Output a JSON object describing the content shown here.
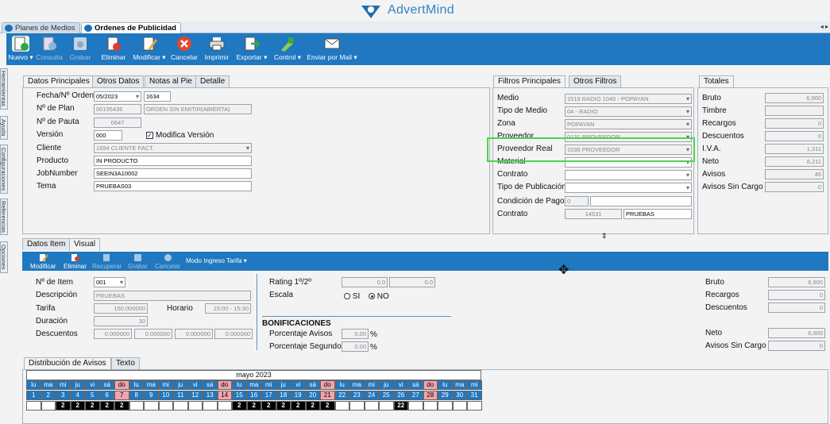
{
  "brand": {
    "name": "AdvertMind"
  },
  "doc_tabs": [
    {
      "label": "Planes de Medios"
    },
    {
      "label": "Ordenes de Publicidad"
    }
  ],
  "toolbar": [
    {
      "label": "Nuevo",
      "icon": "new-doc-icon"
    },
    {
      "label": "Consulta",
      "icon": "query-icon"
    },
    {
      "label": "Grabar",
      "icon": "save-icon"
    },
    {
      "label": "Eliminar",
      "icon": "delete-icon"
    },
    {
      "label": "Modificar",
      "icon": "edit-icon"
    },
    {
      "label": "Cancelar",
      "icon": "cancel-icon"
    },
    {
      "label": "Imprimir",
      "icon": "print-icon"
    },
    {
      "label": "Exportar",
      "icon": "export-icon"
    },
    {
      "label": "Control",
      "icon": "control-icon"
    },
    {
      "label": "Enviar por Mail",
      "icon": "mail-icon"
    }
  ],
  "side_tabs": [
    "Herramientas",
    "Ayuda",
    "Configuraciones",
    "Referencias",
    "Opciones"
  ],
  "main_tabs": [
    "Datos Principales",
    "Otros Datos",
    "Notas al Pie",
    "Detalle"
  ],
  "datos": {
    "fecha_label": "Fecha/Nº Orden",
    "fecha": "05/2023",
    "orden": "1634",
    "plan_label": "Nº de Plan",
    "plan": "00195436",
    "plan_estado": "ORDEN SIN EMITIR(ABIERTA)",
    "pauta_label": "Nº de Pauta",
    "pauta": "0647",
    "version_label": "Versión",
    "version": "000",
    "modifica_label": "Modifica Versión",
    "cliente_label": "Cliente",
    "cliente": "1654 CLIENTE FACT.",
    "producto_label": "Producto",
    "producto": "IN PRODUCTO",
    "job_label": "JobNumber",
    "job": "SEEIN3A10002",
    "tema_label": "Tema",
    "tema": "PRUEBAS03"
  },
  "filter_tabs": [
    "Filtros Principales",
    "Otros Filtros"
  ],
  "filtros": {
    "medio_label": "Medio",
    "medio": "1519 RADIO 1040 - POPAYAN",
    "tipo_label": "Tipo de Medio",
    "tipo": "04 - RADIO",
    "zona_label": "Zona",
    "zona": "POPAYAN",
    "prov_label": "Proveedor",
    "prov": "0131 PROVEEDOR",
    "provreal_label": "Proveedor Real",
    "provreal": "1036 PROVEEDOR",
    "material_label": "Material",
    "contrato_label": "Contrato",
    "tipopub_label": "Tipo de Publicación",
    "condpago_label": "Condición de Pago",
    "condpago": "0",
    "contrato2_label": "Contrato",
    "contrato2": "14531",
    "contrato2_desc": "PRUEBAS"
  },
  "totales_tab": "Totales",
  "totales": [
    {
      "label": "Bruto",
      "value": "6,900"
    },
    {
      "label": "Timbre",
      "value": ""
    },
    {
      "label": "Recargos",
      "value": "0"
    },
    {
      "label": "Descuentos",
      "value": "0"
    },
    {
      "label": "I.V.A.",
      "value": "1,311"
    },
    {
      "label": "Neto",
      "value": "8,211"
    },
    {
      "label": "Avisos",
      "value": "46"
    },
    {
      "label": "Avisos Sin Cargo",
      "value": "0"
    }
  ],
  "item_tabs": [
    "Datos Item",
    "Visual"
  ],
  "item_toolbar": [
    "Modificar",
    "Eliminar",
    "Recuperar",
    "Grabar",
    "Cancelar"
  ],
  "modo_label": "Modo Ingreso Tarifa",
  "item": {
    "nitem_label": "Nº de Item",
    "nitem": "001",
    "desc_label": "Descripción",
    "desc": "PRUEBAS",
    "tarifa_label": "Tarifa",
    "tarifa": "150.000000",
    "horario_label": "Horario",
    "horario": "15:00 - 15:30",
    "duracion_label": "Duración",
    "duracion": "30",
    "descuentos_label": "Descuentos",
    "descuentos": [
      "0.000000",
      "0.000000",
      "0.000000",
      "0.000000"
    ],
    "rating_label": "Rating 1º/2º",
    "rating1": "0.0",
    "rating2": "0.0",
    "escala_label": "Escala",
    "si": "SI",
    "no": "NO",
    "bonif_label": "BONIFICACIONES",
    "pavisos_label": "Porcentaje Avisos",
    "pavisos": "0.00",
    "psegs_label": "Porcentaje Segundos",
    "psegs": "0.00",
    "pct": "%"
  },
  "item_totales": [
    {
      "label": "Bruto",
      "value": "6,900"
    },
    {
      "label": "Recargos",
      "value": "0"
    },
    {
      "label": "Descuentos",
      "value": "0"
    },
    {
      "label": "Neto",
      "value": "6,900"
    },
    {
      "label": "Avisos Sin Cargo",
      "value": "0"
    }
  ],
  "dist_tabs": [
    "Distribución de Avisos",
    "Texto"
  ],
  "calendar": {
    "month": "mayo 2023",
    "days": [
      "lu",
      "ma",
      "mi",
      "ju",
      "vi",
      "sá",
      "do",
      "lu",
      "ma",
      "mi",
      "ju",
      "vi",
      "sá",
      "do",
      "lu",
      "ma",
      "mi",
      "ju",
      "vi",
      "sá",
      "do",
      "lu",
      "ma",
      "mi",
      "ju",
      "vi",
      "sá",
      "do",
      "lu",
      "ma",
      "mi"
    ],
    "nums": [
      "1",
      "2",
      "3",
      "4",
      "5",
      "6",
      "7",
      "8",
      "9",
      "10",
      "11",
      "12",
      "13",
      "14",
      "15",
      "16",
      "17",
      "18",
      "19",
      "20",
      "21",
      "22",
      "23",
      "24",
      "25",
      "26",
      "27",
      "28",
      "29",
      "30",
      "31"
    ],
    "counts": [
      "",
      "",
      "2",
      "2",
      "2",
      "2",
      "2",
      "",
      "",
      "",
      "",
      "",
      "",
      "",
      "2",
      "2",
      "2",
      "2",
      "2",
      "2",
      "2",
      "",
      "",
      "",
      "",
      "22",
      "",
      "",
      "",
      "",
      ""
    ]
  }
}
